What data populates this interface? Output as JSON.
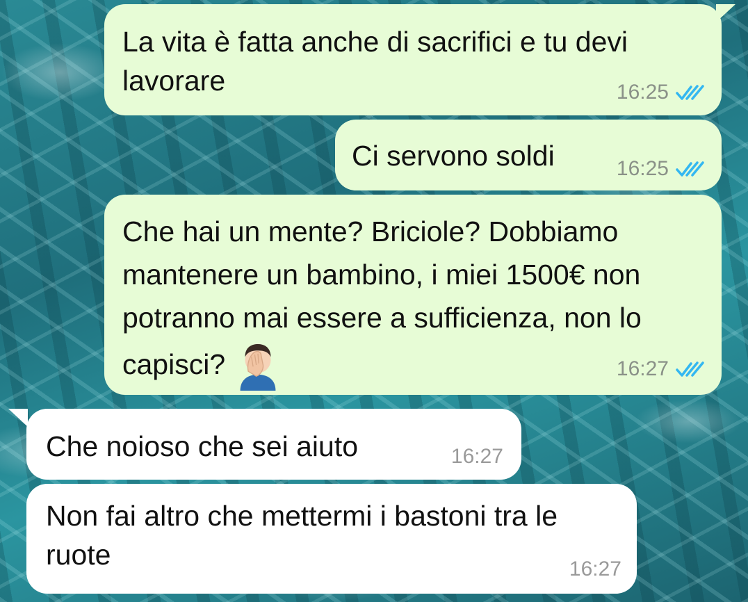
{
  "messages": [
    {
      "direction": "out",
      "text": "La vita è fatta anche di sacrifici e tu devi lavorare",
      "time": "16:25",
      "status": "read-double-check"
    },
    {
      "direction": "out",
      "text": "Ci servono soldi",
      "time": "16:25",
      "status": "read-double-check"
    },
    {
      "direction": "out",
      "text": "Che hai un mente? Briciole? Dobbiamo mantenere un bambino, i miei 1500€ non potranno mai essere a sufficienza, non lo capisci?",
      "emoji": "man-facepalming",
      "time": "16:27",
      "status": "read-double-check"
    },
    {
      "direction": "in",
      "text": "Che noioso che sei aiuto",
      "time": "16:27"
    },
    {
      "direction": "in",
      "text": "Non fai altro che mettermi i bastoni tra le ruote",
      "time": "16:27"
    }
  ],
  "colors": {
    "outgoing_bubble": "#e7fcd6",
    "incoming_bubble": "#ffffff",
    "read_ticks": "#34b7f1",
    "wallpaper": "#2a8a95"
  }
}
